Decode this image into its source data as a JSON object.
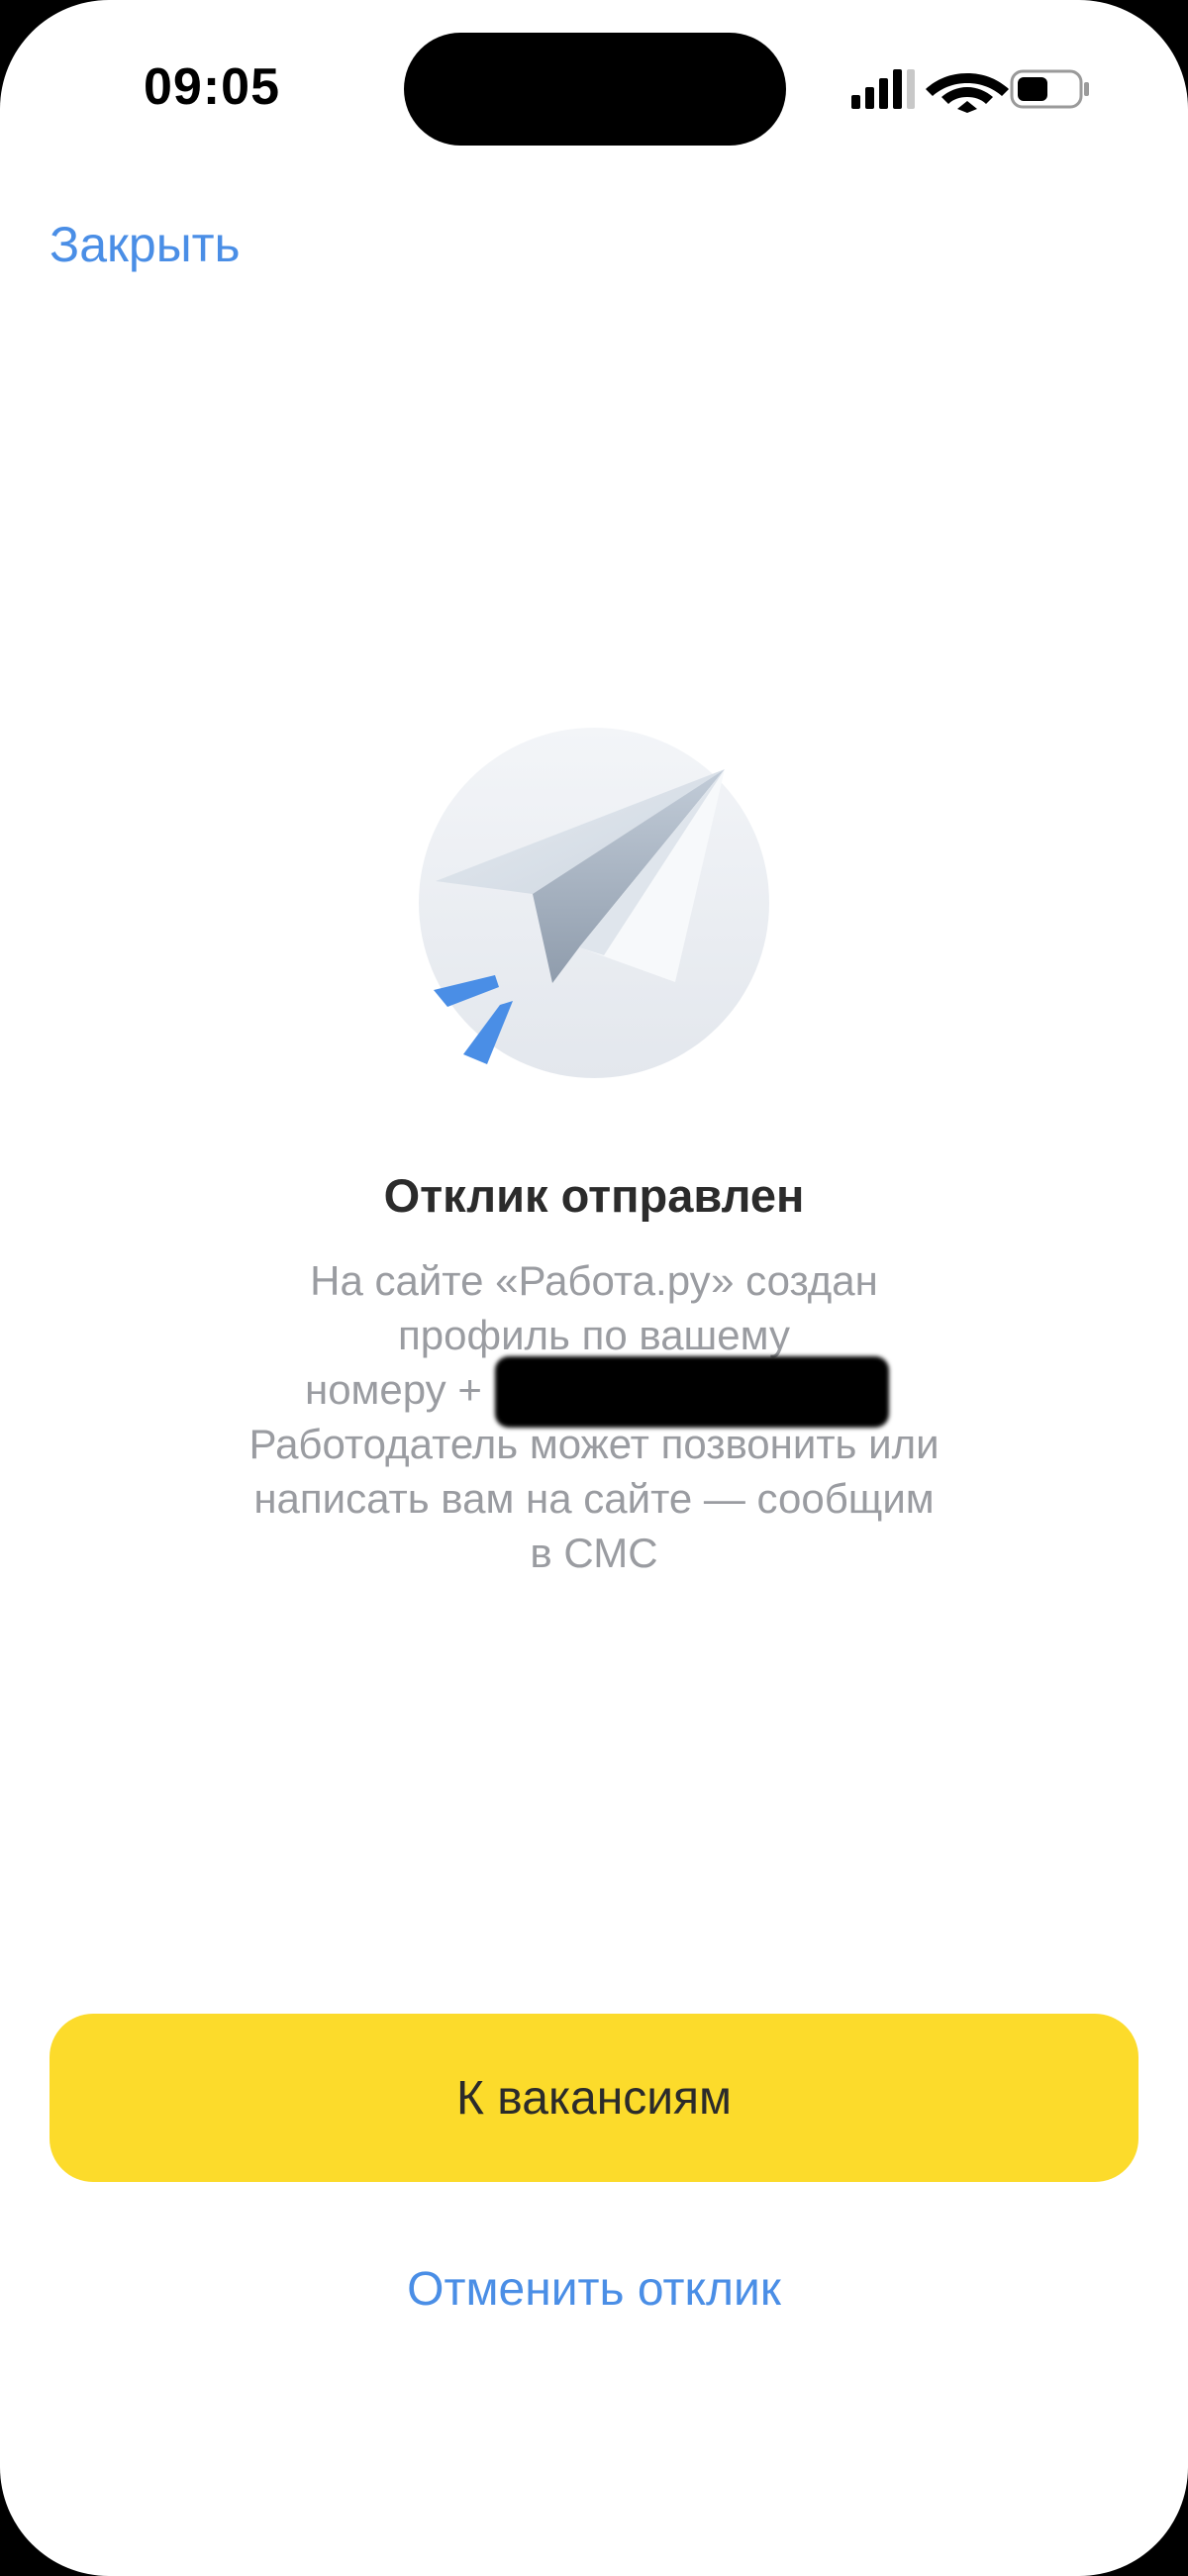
{
  "status_bar": {
    "time": "09:05",
    "icons": [
      "cellular-signal-icon",
      "wifi-icon",
      "battery-icon"
    ]
  },
  "header": {
    "close_label": "Закрыть"
  },
  "illustration": {
    "icon": "paper-plane-icon"
  },
  "confirmation": {
    "title": "Отклик отправлен",
    "lines": [
      "На сайте «Работа.ру» создан",
      "профиль по вашему",
      "номеру +",
      "Работодатель может позвонить или",
      "написать вам на сайте — сообщим",
      "в СМС"
    ]
  },
  "actions": {
    "primary_label": "К вакансиям",
    "cancel_label": "Отменить отклик"
  },
  "colors": {
    "accent_blue": "#4a8ee6",
    "button_yellow": "#fcdb2b",
    "title_text": "#2b2b2b",
    "secondary_text": "#9a9ca1"
  }
}
